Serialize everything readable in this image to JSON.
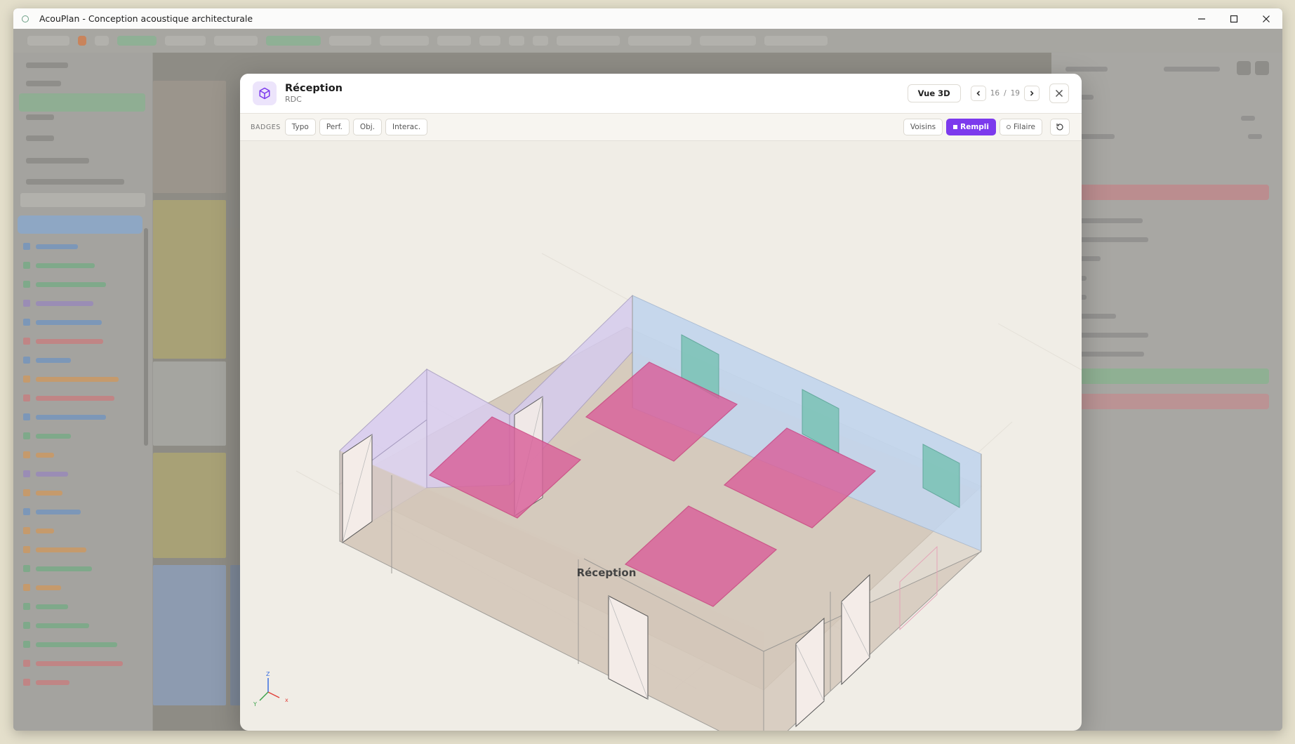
{
  "window": {
    "title": "AcouPlan - Conception acoustique architecturale"
  },
  "modal": {
    "room_name": "Réception",
    "level": "RDC",
    "view_mode_label": "Vue 3D",
    "pager": {
      "current": "16",
      "separator": "/",
      "total": "19"
    },
    "badges_label": "BADGES",
    "badge_buttons": [
      "Typo",
      "Perf.",
      "Obj.",
      "Interac."
    ],
    "display_buttons": {
      "neighbors": "Voisins",
      "filled": "Rempli",
      "wireframe": "Filaire"
    },
    "active_display": "filled",
    "scene_label": "Réception",
    "axes": {
      "x": "x",
      "y": "Y",
      "z": "Z"
    },
    "colors": {
      "accent": "#7c3aed",
      "floor": "#d6cbbd",
      "wall_left": "#dcd0ee",
      "wall_back": "#c3d5ec",
      "ceiling_panel": "#d9609a",
      "wall_panel": "#7ec4b8"
    }
  }
}
